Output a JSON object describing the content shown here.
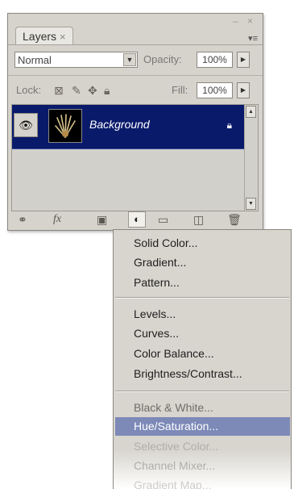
{
  "panel": {
    "tab_label": "Layers",
    "tab_close": "×",
    "window_controls": "– ×",
    "menu_toggle": "▾≡",
    "blend_mode": "Normal",
    "opacity_label": "Opacity:",
    "opacity_value": "100%",
    "lock_label": "Lock:",
    "fill_label": "Fill:",
    "fill_value": "100%"
  },
  "layers": [
    {
      "name": "Background",
      "visible": true,
      "locked": true
    }
  ],
  "bottom_icons": [
    "link-icon",
    "fx-icon",
    "mask-icon",
    "adjustment-icon",
    "group-icon",
    "new-layer-icon",
    "trash-icon"
  ],
  "bottom_labels": {
    "link": "⚭",
    "fx": "fx",
    "adjust": "◐"
  },
  "menu": {
    "group1": [
      "Solid Color...",
      "Gradient...",
      "Pattern..."
    ],
    "group2": [
      "Levels...",
      "Curves...",
      "Color Balance...",
      "Brightness/Contrast..."
    ],
    "group3": [
      "Black & White...",
      "Hue/Saturation...",
      "Selective Color...",
      "Channel Mixer...",
      "Gradient Map..."
    ],
    "selected": "Hue/Saturation..."
  },
  "colors": {
    "panel_bg": "#d6d3cc",
    "selection_row": "#0a1a6b",
    "menu_highlight": "#7d8ab8"
  }
}
